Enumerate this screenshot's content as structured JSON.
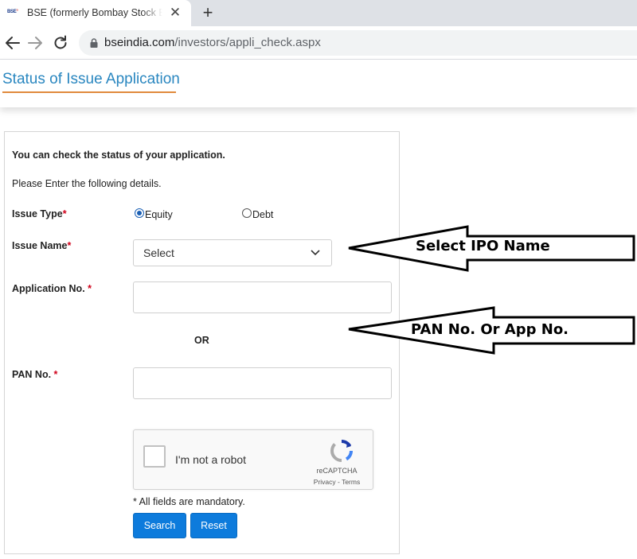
{
  "browser": {
    "tab": {
      "favicon_text": "BSE",
      "title": "BSE (formerly Bombay Stock Exchange)",
      "close_glyph": "✕"
    },
    "new_tab_glyph": "+",
    "url": {
      "host": "bseindia.com",
      "path": "/investors/appli_check.aspx"
    },
    "icons": [
      "back-arrow-icon",
      "forward-arrow-icon",
      "reload-icon",
      "lock-icon"
    ]
  },
  "page": {
    "title": "Status of Issue Application",
    "accent_color": "#2a87c0",
    "underline_color": "#e08a3c"
  },
  "form": {
    "intro": "You can check the status of your application.",
    "instruction": "Please Enter the following details.",
    "issue_type": {
      "label": "Issue Type",
      "required_mark": "*",
      "options": [
        {
          "label": "Equity",
          "checked": true
        },
        {
          "label": "Debt",
          "checked": false
        }
      ]
    },
    "issue_name": {
      "label": "Issue Name",
      "required_mark": "*",
      "selected": "Select"
    },
    "application_no": {
      "label": "Application No. ",
      "required_mark": "*",
      "value": ""
    },
    "or_text": "OR",
    "pan_no": {
      "label": "PAN No. ",
      "required_mark": "*",
      "value": ""
    },
    "captcha": {
      "label": "I'm not a robot",
      "brand": "reCAPTCHA",
      "privacy": "Privacy",
      "separator": " - ",
      "terms": "Terms"
    },
    "mandatory_note": "* All fields are mandatory.",
    "search_button": "Search",
    "reset_button": "Reset",
    "button_color": "#0d7bdc"
  },
  "annotations": {
    "arrow_1": "Select IPO Name",
    "arrow_2": "PAN No. Or App No."
  }
}
